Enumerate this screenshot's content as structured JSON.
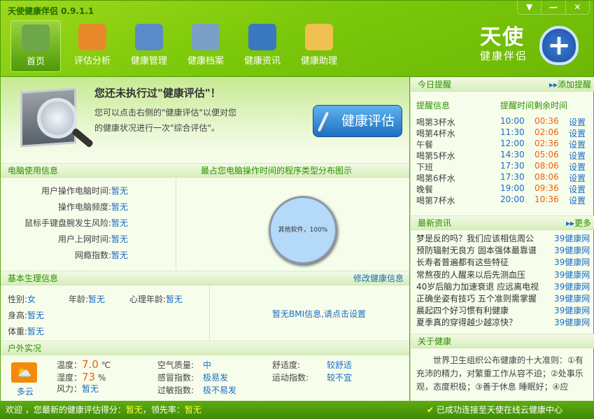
{
  "app": {
    "title": "天使健康伴侣 0.9.1.1",
    "logo_big": "天使",
    "logo_small": "健康伴侣",
    "window_buttons": [
      "▼",
      "—",
      "✕"
    ]
  },
  "nav": [
    {
      "label": "首页",
      "icon": "home-icon",
      "active": true
    },
    {
      "label": "评估分析",
      "icon": "chart-icon"
    },
    {
      "label": "健康管理",
      "icon": "target-icon"
    },
    {
      "label": "健康档案",
      "icon": "files-icon"
    },
    {
      "label": "健康资讯",
      "icon": "globe-icon"
    },
    {
      "label": "健康助理",
      "icon": "clock-note-icon"
    }
  ],
  "hero": {
    "title": "您还未执行过\"健康评估\"！",
    "desc": "您可以点击右侧的\"健康评估\"以便对您的健康状况进行一次\"综合评估\"。",
    "button": "健康评估"
  },
  "pc": {
    "title": "电脑使用信息",
    "chart_title": "最占您电脑操作时间的程序类型分布图示",
    "items": [
      {
        "label": "用户操作电脑时间:",
        "value": "暂无"
      },
      {
        "label": "操作电脑频度:",
        "value": "暂无"
      },
      {
        "label": "鼠标手键盘腕发生风险:",
        "value": "暂无"
      },
      {
        "label": "用户上网时间:",
        "value": "暂无"
      },
      {
        "label": "网瘾指数:",
        "value": "暂无"
      }
    ]
  },
  "chart_data": {
    "type": "pie",
    "categories": [
      "其他软件"
    ],
    "values": [
      100
    ],
    "labels": [
      "其他软件，100%"
    ],
    "colors": [
      "#b5d9f8"
    ]
  },
  "basic": {
    "title": "基本生理信息",
    "edit": "修改健康信息",
    "gender_label": "性别:",
    "gender": "女",
    "age_label": "年龄:",
    "age": "暂无",
    "mental_label": "心理年龄:",
    "mental": "暂无",
    "height_label": "身高:",
    "height": "暂无",
    "weight_label": "体重:",
    "weight": "暂无",
    "bmi": "暂无BMI信息,请点击设置"
  },
  "outdoor": {
    "title": "户外实况",
    "weather": "多云",
    "temp_label": "温度：",
    "temp": "7.0",
    "temp_unit": "℃",
    "hum_label": "湿度：",
    "hum": "73",
    "hum_unit": "%",
    "wind_label": "风力：",
    "wind": "暂无",
    "air_label": "空气质量:",
    "air": "中",
    "cold_label": "感冒指数:",
    "cold": "极易发",
    "allergy_label": "过敏指数:",
    "allergy": "极不易发",
    "comfort_label": "舒适度:",
    "comfort": "较舒适",
    "sport_label": "运动指数:",
    "sport": "较不宜"
  },
  "reminders": {
    "title": "今日提醒",
    "add": "添加提醒",
    "col_info": "提醒信息",
    "col_time": "提醒时间",
    "col_left": "剩余时间",
    "action": "设置",
    "items": [
      [
        "喝第3杯水",
        "10:00",
        "00:36"
      ],
      [
        "喝第4杯水",
        "11:30",
        "02:06"
      ],
      [
        "午餐",
        "12:00",
        "02:36"
      ],
      [
        "喝第5杯水",
        "14:30",
        "05:06"
      ],
      [
        "下班",
        "17:30",
        "08:06"
      ],
      [
        "喝第6杯水",
        "17:30",
        "08:06"
      ],
      [
        "晚餐",
        "19:00",
        "09:36"
      ],
      [
        "喝第7杯水",
        "20:00",
        "10:36"
      ]
    ]
  },
  "news": {
    "title": "最新资讯",
    "more": "更多",
    "source": "39健康网",
    "items": [
      "梦是反的吗？我们应该相信周公",
      "预防辐射无良方 固本强体最靠谱",
      "长寿者普遍都有这些特征",
      "常熬夜的人醒来以后先测血压",
      "40岁后脑力加速衰退 应远离电视",
      "正确坐姿有技巧 五个准则需掌握",
      "晨起四个好习惯有利健康",
      "夏季真的穿得越少越凉快？"
    ]
  },
  "about": {
    "title": "关于健康",
    "text": "世界卫生组织公布健康的十大准则：①有充沛的精力，对繁重工作从容不迫；②处事乐观，态度积极；③善于休息 睡眠好；④应"
  },
  "status": {
    "prefix": "欢迎 ，您最新的健康评估得分：",
    "score": "暂无",
    "mid": "，领先率：",
    "rate": "暂无",
    "connection": "已成功连接至天使在线云健康中心"
  }
}
